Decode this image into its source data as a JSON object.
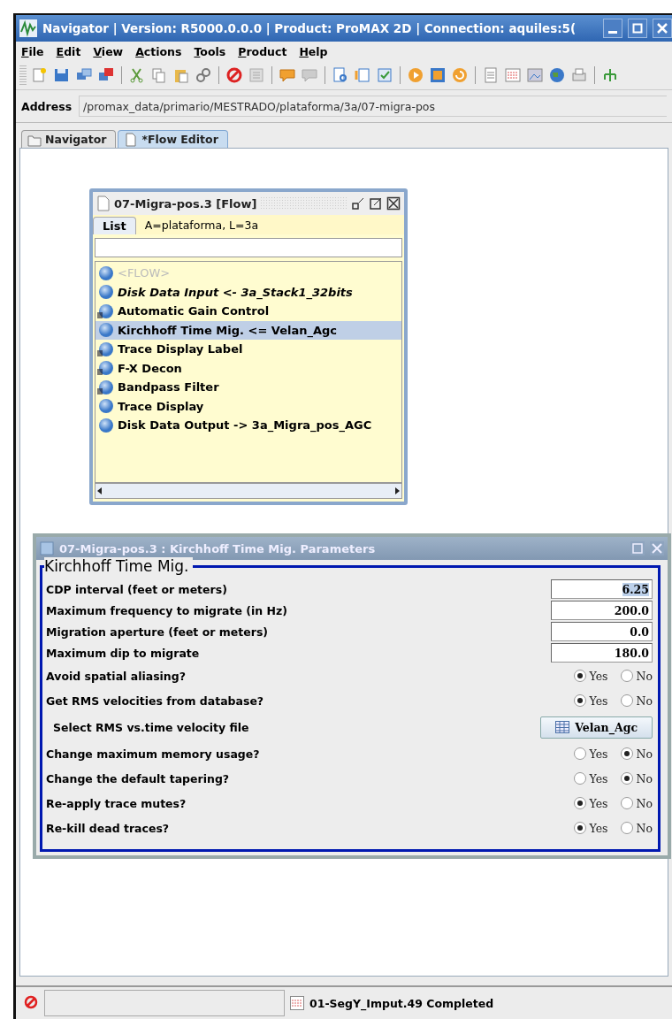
{
  "window": {
    "title": "Navigator | Version: R5000.0.0.0 | Product: ProMAX 2D | Connection: aquiles:5("
  },
  "menu": [
    {
      "label": "File"
    },
    {
      "label": "Edit"
    },
    {
      "label": "View"
    },
    {
      "label": "Actions"
    },
    {
      "label": "Tools"
    },
    {
      "label": "Product"
    },
    {
      "label": "Help"
    }
  ],
  "address": {
    "label": "Address",
    "value": "/promax_data/primario/MESTRADO/plataforma/3a/07-migra-pos"
  },
  "tabs": [
    {
      "label": "Navigator",
      "selected": false
    },
    {
      "label": "*Flow Editor",
      "selected": true
    }
  ],
  "flow_window": {
    "title": "07-Migra-pos.3 [Flow]",
    "tab": "List",
    "path": "A=plataforma, L=3a",
    "items": [
      {
        "label": "<FLOW>",
        "disabled": true,
        "italic": false,
        "flagged": false,
        "selected": false
      },
      {
        "label": "Disk Data Input <- 3a_Stack1_32bits",
        "disabled": false,
        "italic": true,
        "flagged": false,
        "selected": false
      },
      {
        "label": "Automatic Gain Control",
        "disabled": false,
        "italic": false,
        "flagged": true,
        "selected": false
      },
      {
        "label": "Kirchhoff Time Mig. <= Velan_Agc",
        "disabled": false,
        "italic": false,
        "flagged": false,
        "selected": true
      },
      {
        "label": "Trace Display Label",
        "disabled": false,
        "italic": false,
        "flagged": true,
        "selected": false
      },
      {
        "label": "F-X Decon",
        "disabled": false,
        "italic": false,
        "flagged": true,
        "selected": false
      },
      {
        "label": "Bandpass Filter",
        "disabled": false,
        "italic": false,
        "flagged": true,
        "selected": false
      },
      {
        "label": "Trace Display",
        "disabled": false,
        "italic": false,
        "flagged": false,
        "selected": false
      },
      {
        "label": "Disk Data Output -> 3a_Migra_pos_AGC",
        "disabled": false,
        "italic": false,
        "flagged": false,
        "selected": false
      }
    ]
  },
  "params_window": {
    "title": "07-Migra-pos.3 : Kirchhoff Time Mig. Parameters",
    "group": "Kirchhoff Time Mig.",
    "rows": [
      {
        "kind": "number",
        "label": "CDP interval (feet or meters)",
        "value": "6.25",
        "highlighted": true
      },
      {
        "kind": "number",
        "label": "Maximum frequency to migrate (in Hz)",
        "value": "200.0",
        "highlighted": false
      },
      {
        "kind": "number",
        "label": "Migration aperture (feet or meters)",
        "value": "0.0",
        "highlighted": false
      },
      {
        "kind": "number",
        "label": "Maximum dip to migrate",
        "value": "180.0",
        "highlighted": false
      },
      {
        "kind": "choice",
        "label": "Avoid spatial aliasing?",
        "options": [
          {
            "label": "Yes",
            "selected": true
          },
          {
            "label": "No",
            "selected": false
          }
        ]
      },
      {
        "kind": "choice",
        "label": "Get RMS velocities from database?",
        "options": [
          {
            "label": "Yes",
            "selected": true
          },
          {
            "label": "No",
            "selected": false
          }
        ]
      },
      {
        "kind": "file",
        "label": "Select RMS vs.time velocity file",
        "value": "Velan_Agc"
      },
      {
        "kind": "choice",
        "label": "Change maximum memory usage?",
        "options": [
          {
            "label": "Yes",
            "selected": false
          },
          {
            "label": "No",
            "selected": true
          }
        ]
      },
      {
        "kind": "choice",
        "label": "Change the default tapering?",
        "options": [
          {
            "label": "Yes",
            "selected": false
          },
          {
            "label": "No",
            "selected": true
          }
        ]
      },
      {
        "kind": "choice",
        "label": "Re-apply trace mutes?",
        "options": [
          {
            "label": "Yes",
            "selected": true
          },
          {
            "label": "No",
            "selected": false
          }
        ]
      },
      {
        "kind": "choice",
        "label": "Re-kill dead traces?",
        "options": [
          {
            "label": "Yes",
            "selected": true
          },
          {
            "label": "No",
            "selected": false
          }
        ]
      }
    ]
  },
  "status_bar": {
    "message": "01-SegY_Imput.49 Completed"
  }
}
